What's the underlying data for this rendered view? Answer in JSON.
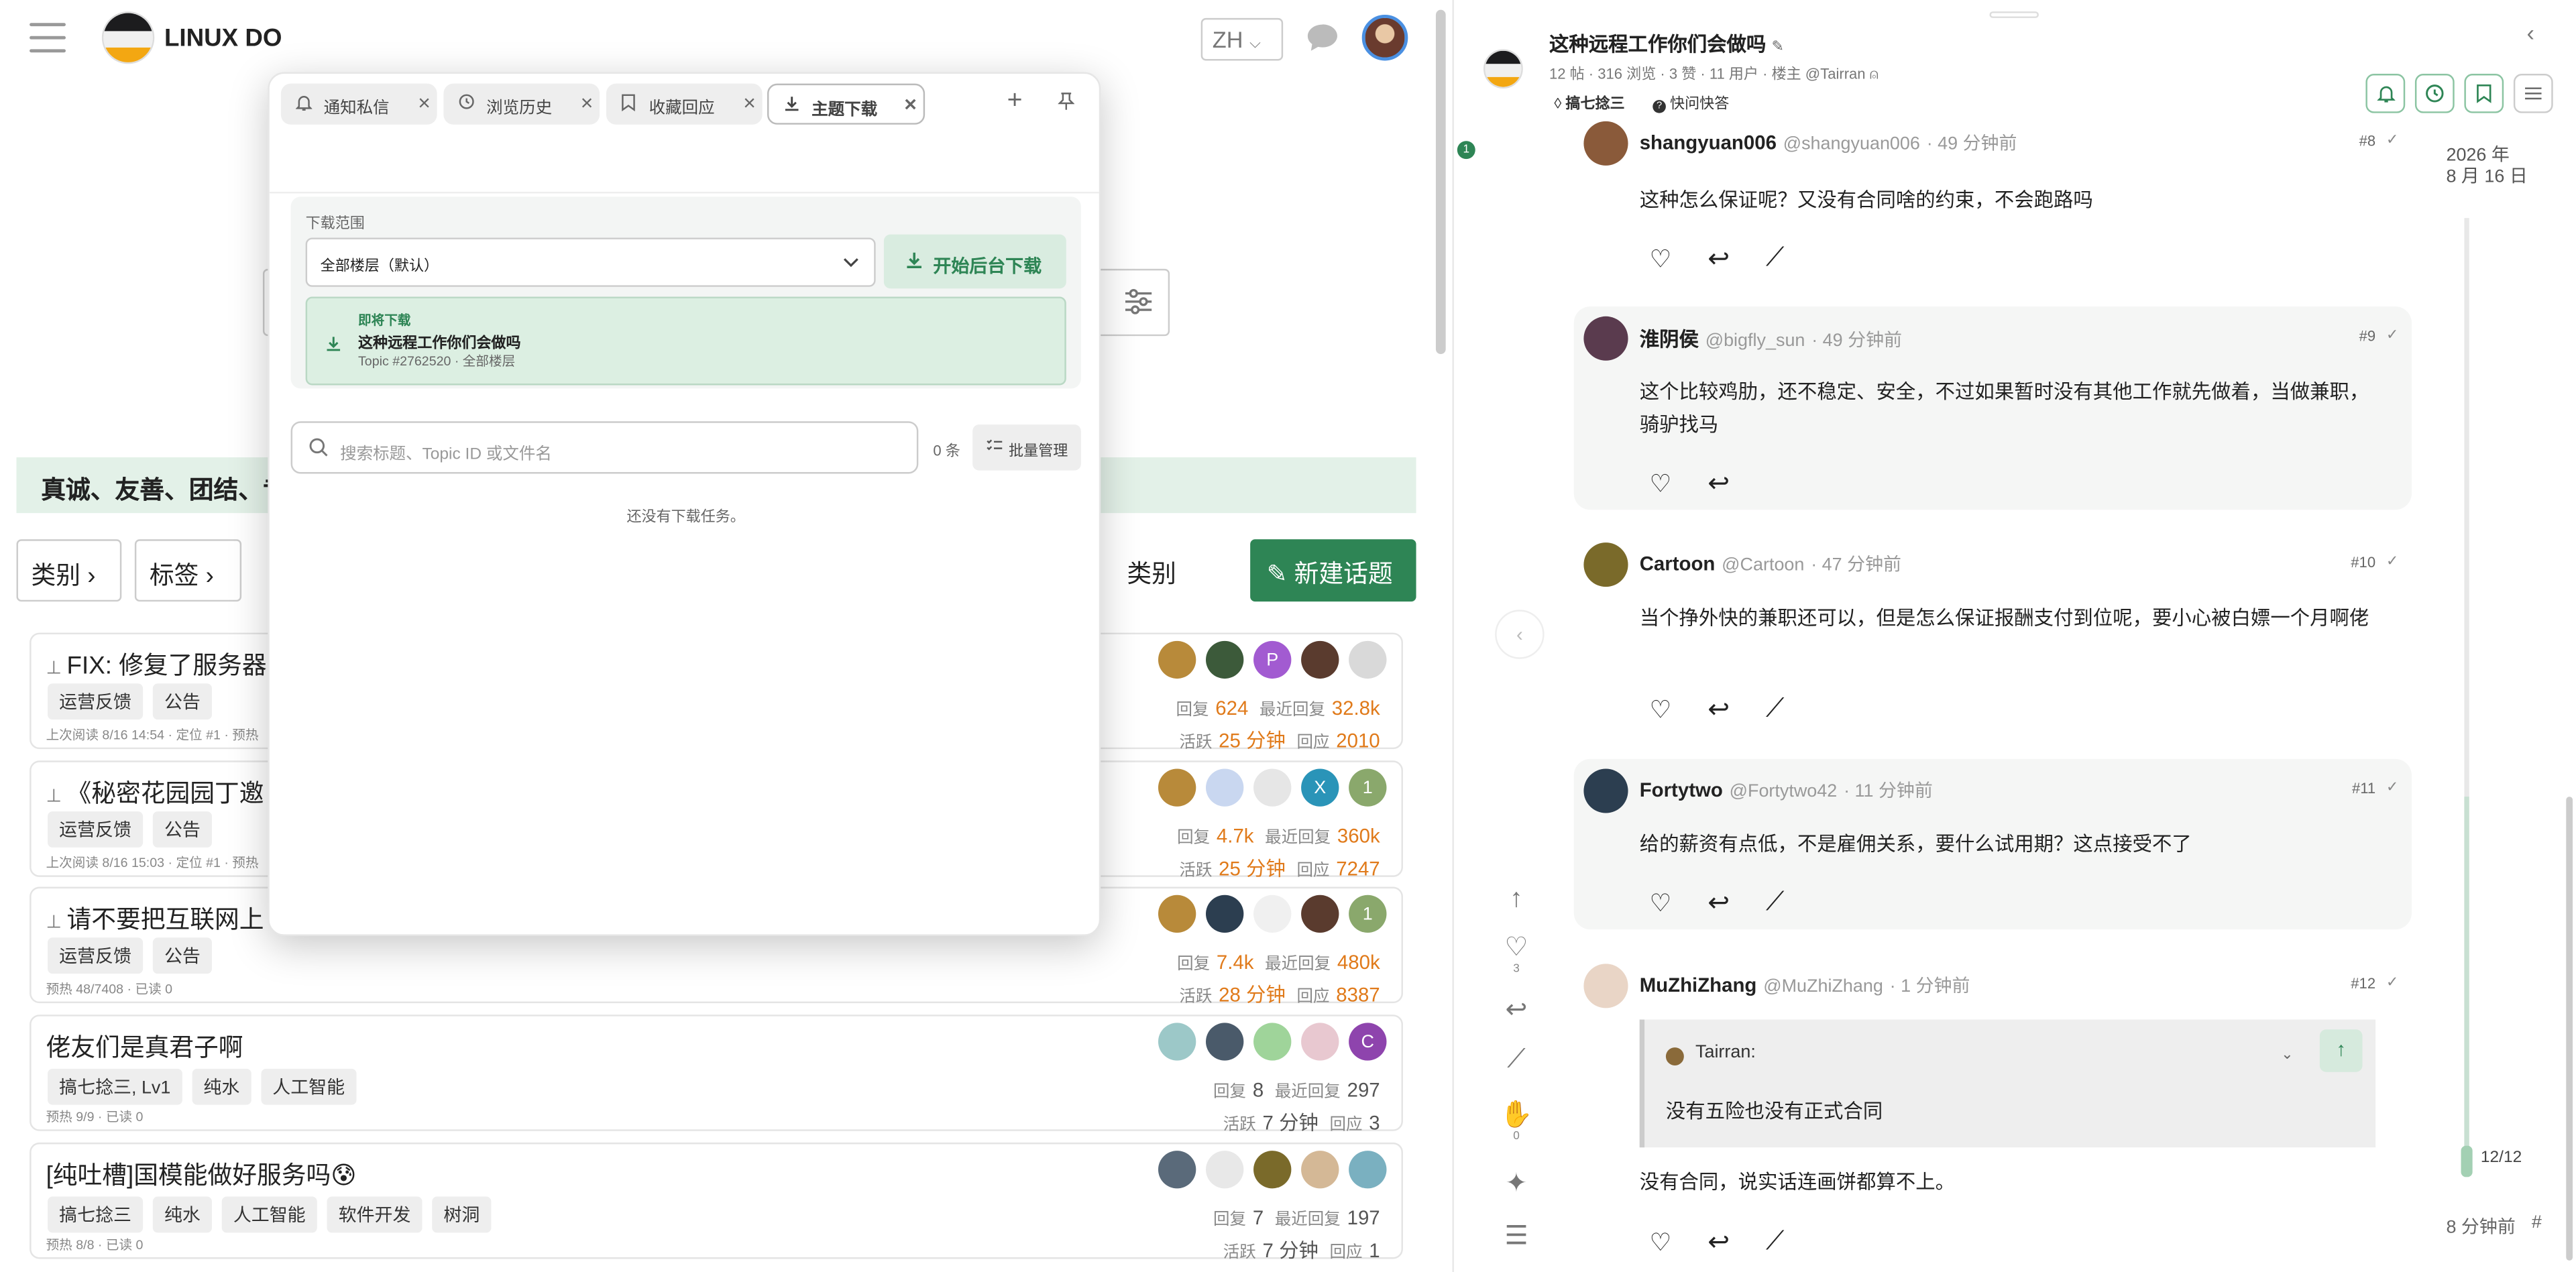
{
  "site": {
    "name": "LINUX DO",
    "lang": "ZH"
  },
  "left": {
    "banner": "真诚、友善、团结、专",
    "nav": {
      "categories": "类别",
      "tags": "标签",
      "category_label": "类别",
      "new_topic": "新建话题"
    },
    "topics": [
      {
        "title": "FIX: 修复了服务器",
        "pinned": true,
        "tags": [
          "运营反馈",
          "公告"
        ],
        "meta": "上次阅读 8/16 14:54 · 定位 #1 · 预热",
        "avatars": [
          "",
          "",
          "P",
          "",
          ""
        ],
        "replies_label": "回复",
        "replies": "624",
        "latest_label": "最近回复",
        "latest": "32.8k",
        "activity_label": "活跃",
        "activity": "25 分钟",
        "reply_label": "回应",
        "reply_count": "2010"
      },
      {
        "title": "《秘密花园园丁邀",
        "pinned": true,
        "tags": [
          "运营反馈",
          "公告"
        ],
        "meta": "上次阅读 8/16 15:03 · 定位 #1 · 预热",
        "avatars": [
          "",
          "",
          "",
          "X",
          "1"
        ],
        "replies_label": "回复",
        "replies": "4.7k",
        "latest_label": "最近回复",
        "latest": "360k",
        "activity_label": "活跃",
        "activity": "25 分钟",
        "reply_label": "回应",
        "reply_count": "7247"
      },
      {
        "title": "请不要把互联网上",
        "pinned": true,
        "tags": [
          "运营反馈",
          "公告"
        ],
        "meta": "预热 48/7408 · 已读 0",
        "avatars": [
          "",
          "",
          "",
          "",
          "1"
        ],
        "replies_label": "回复",
        "replies": "7.4k",
        "latest_label": "最近回复",
        "latest": "480k",
        "activity_label": "活跃",
        "activity": "28 分钟",
        "reply_label": "回应",
        "reply_count": "8387"
      },
      {
        "title": "佬友们是真君子啊",
        "pinned": false,
        "tags": [
          "搞七捻三, Lv1",
          "纯水",
          "人工智能"
        ],
        "meta": "预热 9/9 · 已读 0",
        "avatars": [
          "",
          "",
          "",
          "",
          "C"
        ],
        "replies_label": "回复",
        "replies": "8",
        "latest_label": "最近回复",
        "latest": "297",
        "activity_label": "活跃",
        "activity": "7 分钟",
        "reply_label": "回应",
        "reply_count": "3"
      },
      {
        "title": "[纯吐槽]国模能做好服务吗😰",
        "pinned": false,
        "tags": [
          "搞七捻三",
          "纯水",
          "人工智能",
          "软件开发",
          "树洞"
        ],
        "meta": "预热 8/8 · 已读 0",
        "avatars": [
          "",
          "",
          "",
          "",
          ""
        ],
        "replies_label": "回复",
        "replies": "7",
        "latest_label": "最近回复",
        "latest": "197",
        "activity_label": "活跃",
        "activity": "7 分钟",
        "reply_label": "回应",
        "reply_count": "1"
      }
    ]
  },
  "popup": {
    "tabs": [
      "通知私信",
      "浏览历史",
      "收藏回应",
      "主题下载"
    ],
    "active_tab": "主题下载",
    "range_label": "下载范围",
    "range_value": "全部楼层（默认）",
    "start_button": "开始后台下载",
    "next_label": "即将下载",
    "next_title": "这种远程工作你们会做吗",
    "next_sub": "Topic #2762520 · 全部楼层",
    "search_placeholder": "搜索标题、Topic ID 或文件名",
    "count": "0 条",
    "batch": "批量管理",
    "empty": "还没有下载任务。"
  },
  "topic": {
    "title": "这种远程工作你们会做吗",
    "meta": "12 帖 · 316 浏览 · 3 赞 · 11 用户 · 楼主 @Tairran",
    "tags": [
      "搞七捻三",
      "快问快答"
    ],
    "timeline": {
      "year": "2026 年",
      "date": "8 月 16 日",
      "position": "12/12",
      "ago": "8 分钟前",
      "hash": "#"
    },
    "side_counts": {
      "like": "3",
      "flag": "0"
    },
    "new_badge": "1",
    "posts": [
      {
        "name": "shangyuan006",
        "handle": "@shangyuan006",
        "time": "· 49 分钟前",
        "num": "#8",
        "text": "这种怎么保证呢？又没有合同啥的约束，不会跑路吗"
      },
      {
        "name": "淮阴侯",
        "handle": "@bigfly_sun",
        "time": "· 49 分钟前",
        "num": "#9",
        "text": "这个比较鸡肋，还不稳定、安全，不过如果暂时没有其他工作就先做着，当做兼职，骑驴找马"
      },
      {
        "name": "Cartoon",
        "handle": "@Cartoon",
        "time": "· 47 分钟前",
        "num": "#10",
        "text": "当个挣外快的兼职还可以，但是怎么保证报酬支付到位呢，要小心被白嫖一个月啊佬"
      },
      {
        "name": "Fortytwo",
        "handle": "@Fortytwo42",
        "time": "· 11 分钟前",
        "num": "#11",
        "text": "给的薪资有点低，不是雇佣关系，要什么试用期？这点接受不了"
      },
      {
        "name": "MuZhiZhang",
        "handle": "@MuZhiZhang",
        "time": "· 1 分钟前",
        "num": "#12",
        "quote_author": "Tairran:",
        "quote_text": "没有五险也没有正式合同",
        "text": "没有合同，说实话连画饼都算不上。"
      }
    ]
  }
}
